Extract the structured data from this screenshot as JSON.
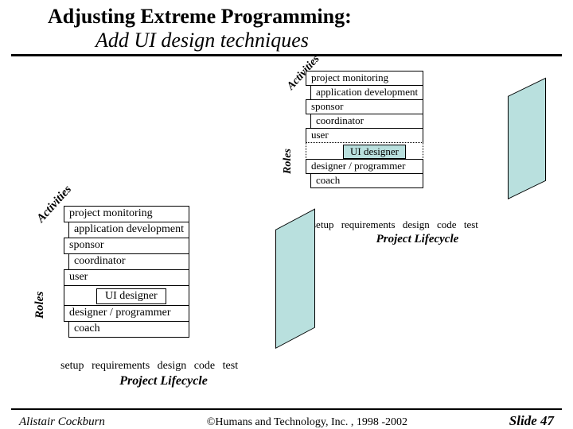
{
  "title": {
    "line1": "Adjusting Extreme Programming:",
    "line2": "Add UI design techniques"
  },
  "labels": {
    "activities": "Activities",
    "roles": "Roles",
    "project_lifecycle": "Project Lifecycle"
  },
  "diagram": {
    "activities": [
      "project monitoring",
      "application development"
    ],
    "roles": [
      "sponsor",
      "coordinator",
      "user"
    ],
    "highlight_role": "UI designer",
    "extra_roles": [
      "designer / programmer",
      "coach"
    ],
    "phases": [
      "setup",
      "requirements",
      "design",
      "code",
      "test"
    ]
  },
  "footer": {
    "author": "Alistair Cockburn",
    "copyright": "©Humans and Technology, Inc. , 1998 -2002",
    "slide": "Slide 47"
  },
  "colors": {
    "accent": "#b9e0de"
  }
}
